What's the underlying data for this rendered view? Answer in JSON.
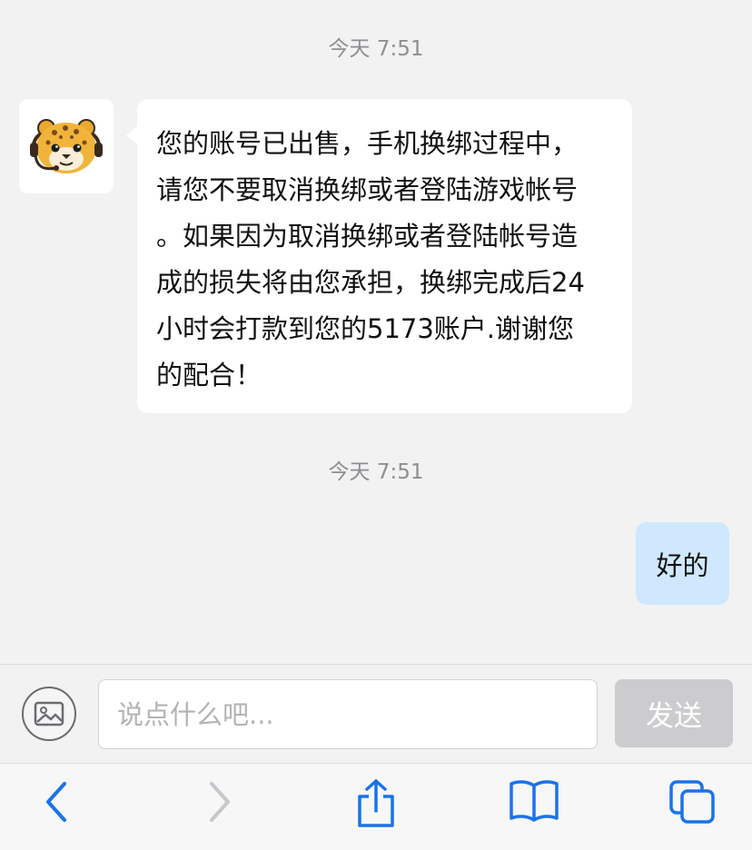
{
  "chat": {
    "timestamp_1": "今天 7:51",
    "timestamp_2": "今天 7:51",
    "incoming_message": {
      "lines": [
        "您的账号已出售，手机换绑过程中，",
        "请您不要取消换绑或者登陆游戏帐号",
        "。如果因为取消换绑或者登陆帐号造",
        "成的损失将由您承担，换绑完成后24",
        "小时会打款到您的5173账户.谢谢您",
        "的配合！"
      ]
    },
    "outgoing_message": "好的"
  },
  "input_bar": {
    "placeholder": "说点什么吧...",
    "value": "",
    "send_label": "发送",
    "image_button_icon": "image-icon"
  },
  "browser_toolbar": {
    "icons": [
      "back-icon",
      "forward-icon",
      "share-icon",
      "bookmarks-icon",
      "tabs-icon"
    ],
    "active_color": "#1a73e8",
    "disabled_color": "#c7c7cc"
  },
  "colors": {
    "background": "#f2f2f3",
    "incoming_bubble": "#ffffff",
    "outgoing_bubble": "#cfe8fd",
    "send_button_disabled": "#cccccf"
  }
}
